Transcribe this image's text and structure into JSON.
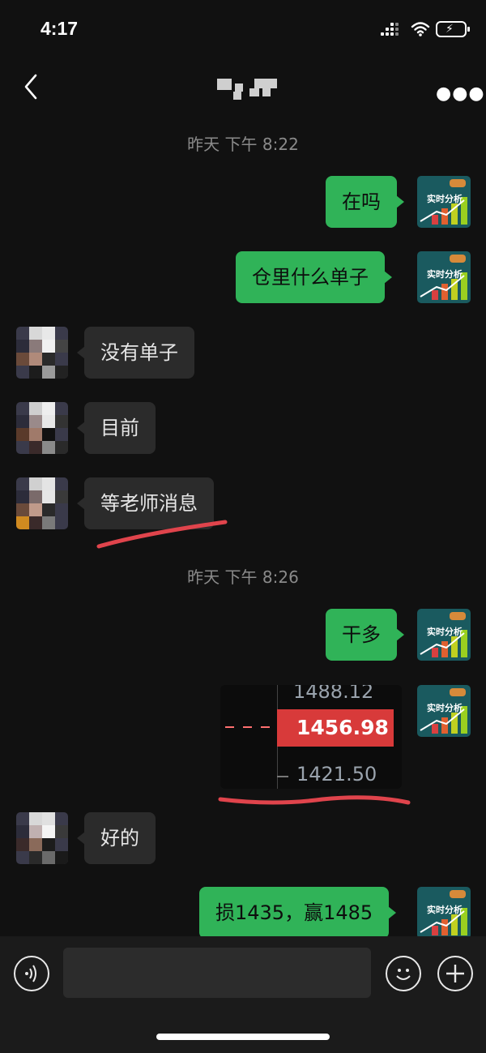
{
  "status_bar": {
    "time": "4:17"
  },
  "header": {
    "back_icon": "chevron-left-icon",
    "more_icon": "ellipsis-icon",
    "title_pixelated": true
  },
  "messages": [
    {
      "kind": "timestamp",
      "text": "昨天 下午 8:22"
    },
    {
      "kind": "text",
      "from": "me",
      "text": "在吗"
    },
    {
      "kind": "text",
      "from": "me",
      "text": "仓里什么单子"
    },
    {
      "kind": "text",
      "from": "other",
      "text": "没有单子"
    },
    {
      "kind": "text",
      "from": "other",
      "text": "目前"
    },
    {
      "kind": "text",
      "from": "other",
      "text": "等老师消息",
      "highlighted": true
    },
    {
      "kind": "timestamp",
      "text": "昨天 下午 8:26"
    },
    {
      "kind": "text",
      "from": "me",
      "text": "干多"
    },
    {
      "kind": "image",
      "from": "me",
      "image": {
        "price_top": "1488.12",
        "price_current": "1456.98",
        "price_bottom": "1421.50"
      },
      "highlighted": true
    },
    {
      "kind": "text",
      "from": "other",
      "text": "好的"
    },
    {
      "kind": "text",
      "from": "me",
      "text": "损1435，赢1485"
    }
  ],
  "my_avatar": {
    "label": "实时分析",
    "accent": "#30b358"
  },
  "input_bar": {
    "voice_icon": "voice-icon",
    "emoji_icon": "emoji-icon",
    "plus_icon": "plus-icon",
    "value": ""
  },
  "colors": {
    "background": "#111111",
    "my_bubble": "#30b358",
    "other_bubble": "#2b2b2b",
    "highlight": "#e0444c",
    "price_red": "#d83a3a"
  }
}
